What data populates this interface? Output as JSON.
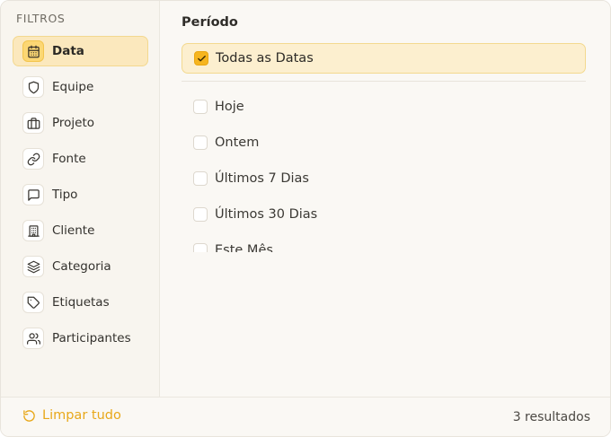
{
  "sidebar": {
    "title": "FILTROS",
    "items": [
      {
        "label": "Data",
        "icon": "calendar-icon",
        "active": true
      },
      {
        "label": "Equipe",
        "icon": "shield-icon",
        "active": false
      },
      {
        "label": "Projeto",
        "icon": "briefcase-icon",
        "active": false
      },
      {
        "label": "Fonte",
        "icon": "link-icon",
        "active": false
      },
      {
        "label": "Tipo",
        "icon": "message-square-icon",
        "active": false
      },
      {
        "label": "Cliente",
        "icon": "building-icon",
        "active": false
      },
      {
        "label": "Categoria",
        "icon": "layers-icon",
        "active": false
      },
      {
        "label": "Etiquetas",
        "icon": "tag-icon",
        "active": false
      },
      {
        "label": "Participantes",
        "icon": "users-icon",
        "active": false
      }
    ]
  },
  "main": {
    "section_title": "Período",
    "selected_option": {
      "label": "Todas as Datas",
      "checked": true
    },
    "options": [
      {
        "label": "Hoje",
        "checked": false
      },
      {
        "label": "Ontem",
        "checked": false
      },
      {
        "label": "Últimos 7 Dias",
        "checked": false
      },
      {
        "label": "Últimos 30 Dias",
        "checked": false
      },
      {
        "label": "Este Mês",
        "checked": false
      }
    ]
  },
  "footer": {
    "clear_label": "Limpar tudo",
    "result_count": "3 resultados"
  },
  "colors": {
    "accent": "#f6b51f",
    "accent_text": "#e8a81a",
    "active_bg": "#fbe8bd"
  }
}
